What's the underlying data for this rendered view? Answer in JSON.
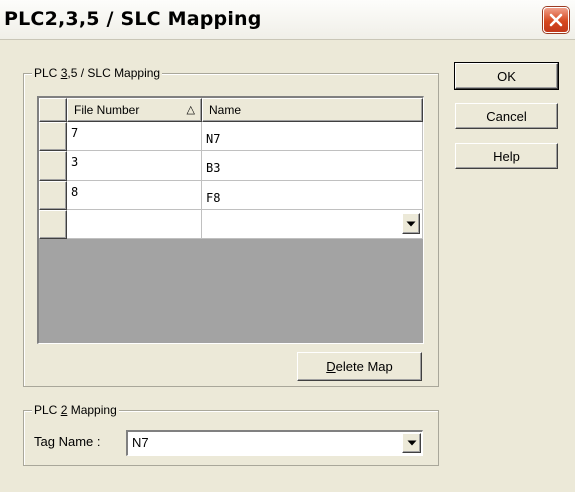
{
  "window": {
    "title": "PLC2,3,5 / SLC Mapping",
    "close_icon": "close-icon"
  },
  "mapping_group": {
    "label_pre": "PLC ",
    "label_key": "3",
    "label_post": ",5 / SLC Mapping",
    "columns": [
      "File Number",
      "Name"
    ],
    "sort_indicator": "△",
    "rows": [
      {
        "file_number": "7",
        "name": "N7"
      },
      {
        "file_number": "3",
        "name": "B3"
      },
      {
        "file_number": "8",
        "name": "F8"
      },
      {
        "file_number": "",
        "name": ""
      }
    ],
    "delete_key": "D",
    "delete_rest": "elete Map"
  },
  "plc2_group": {
    "label_pre": "PLC ",
    "label_key": "2",
    "label_post": " Mapping",
    "tag_label": "Tag Name :",
    "tag_value": "N7"
  },
  "buttons": {
    "ok": "OK",
    "cancel": "Cancel",
    "help": "Help"
  },
  "colors": {
    "dialog_bg": "#ece9d8",
    "close_button": "#d6481f",
    "grid_empty_bg": "#a3a3a3"
  }
}
